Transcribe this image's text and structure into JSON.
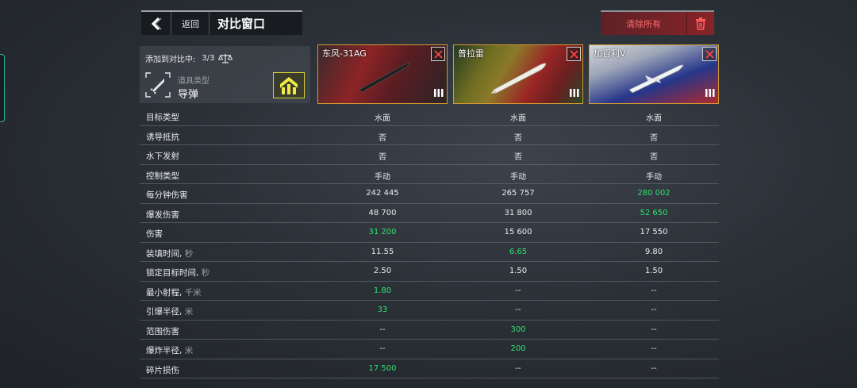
{
  "header": {
    "back_label": "返回",
    "title": "对比窗口",
    "clear_all_label": "清除所有"
  },
  "info": {
    "added_label": "添加到对比中:",
    "added_count": "3/3",
    "type_caption": "道具类型",
    "type_value": "导弹"
  },
  "items": [
    {
      "name": "东风-31AG",
      "tier": "III"
    },
    {
      "name": "普拉雷",
      "tier": "III"
    },
    {
      "name": "加百利V",
      "tier": "III"
    }
  ],
  "colors": {
    "highlight": "#2fe06f",
    "card_border": "#d29a2f",
    "danger": "#ff6b6b"
  },
  "stats": [
    {
      "label": "目标类型",
      "unit": "",
      "values": [
        "水面",
        "水面",
        "水面"
      ],
      "best": [
        false,
        false,
        false
      ]
    },
    {
      "label": "诱导抵抗",
      "unit": "",
      "values": [
        "否",
        "否",
        "否"
      ],
      "best": [
        false,
        false,
        false
      ]
    },
    {
      "label": "水下发射",
      "unit": "",
      "values": [
        "否",
        "否",
        "否"
      ],
      "best": [
        false,
        false,
        false
      ]
    },
    {
      "label": "控制类型",
      "unit": "",
      "values": [
        "手动",
        "手动",
        "手动"
      ],
      "best": [
        false,
        false,
        false
      ]
    },
    {
      "label": "每分钟伤害",
      "unit": "",
      "values": [
        "242 445",
        "265 757",
        "280 002"
      ],
      "best": [
        false,
        false,
        true
      ]
    },
    {
      "label": "爆发伤害",
      "unit": "",
      "values": [
        "48 700",
        "31 800",
        "52 650"
      ],
      "best": [
        false,
        false,
        true
      ]
    },
    {
      "label": "伤害",
      "unit": "",
      "values": [
        "31 200",
        "15 600",
        "17 550"
      ],
      "best": [
        true,
        false,
        false
      ]
    },
    {
      "label": "装填时间, ",
      "unit": "秒",
      "values": [
        "11.55",
        "6.65",
        "9.80"
      ],
      "best": [
        false,
        true,
        false
      ]
    },
    {
      "label": "锁定目标时间, ",
      "unit": "秒",
      "values": [
        "2.50",
        "1.50",
        "1.50"
      ],
      "best": [
        false,
        false,
        false
      ]
    },
    {
      "label": "最小射程, ",
      "unit": "千米",
      "values": [
        "1.80",
        "--",
        "--"
      ],
      "best": [
        true,
        false,
        false
      ]
    },
    {
      "label": "引爆半径, ",
      "unit": "米",
      "values": [
        "33",
        "--",
        "--"
      ],
      "best": [
        true,
        false,
        false
      ]
    },
    {
      "label": "范围伤害",
      "unit": "",
      "values": [
        "--",
        "300",
        "--"
      ],
      "best": [
        false,
        true,
        false
      ]
    },
    {
      "label": "爆炸半径, ",
      "unit": "米",
      "values": [
        "--",
        "200",
        "--"
      ],
      "best": [
        false,
        true,
        false
      ]
    },
    {
      "label": "碎片损伤",
      "unit": "",
      "values": [
        "17 500",
        "--",
        "--"
      ],
      "best": [
        true,
        false,
        false
      ]
    }
  ]
}
